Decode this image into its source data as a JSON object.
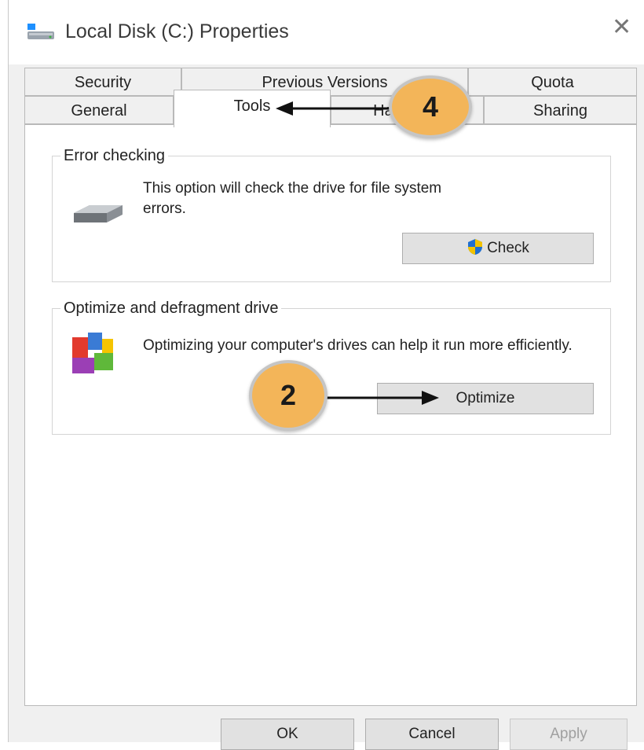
{
  "window": {
    "title": "Local Disk (C:) Properties",
    "close_glyph": "✕"
  },
  "tabs": {
    "row1": [
      {
        "label": "Security"
      },
      {
        "label": "Previous Versions"
      },
      {
        "label": "Quota"
      }
    ],
    "row2": [
      {
        "label": "General"
      },
      {
        "label": "Tools"
      },
      {
        "label": "Hardware"
      },
      {
        "label": "Sharing"
      }
    ]
  },
  "error_checking": {
    "legend": "Error checking",
    "description": "This option will check the drive for file system errors.",
    "button": "Check",
    "button_icon": "uac-shield-icon"
  },
  "optimize": {
    "legend": "Optimize and defragment drive",
    "description": "Optimizing your computer's drives can help it run more efficiently.",
    "button": "Optimize",
    "icon": "defrag-icon"
  },
  "footer": {
    "ok": "OK",
    "cancel": "Cancel",
    "apply": "Apply"
  },
  "annotations": {
    "callout_tools": "4",
    "callout_optimize": "2",
    "callout_color": "#f3b559"
  }
}
